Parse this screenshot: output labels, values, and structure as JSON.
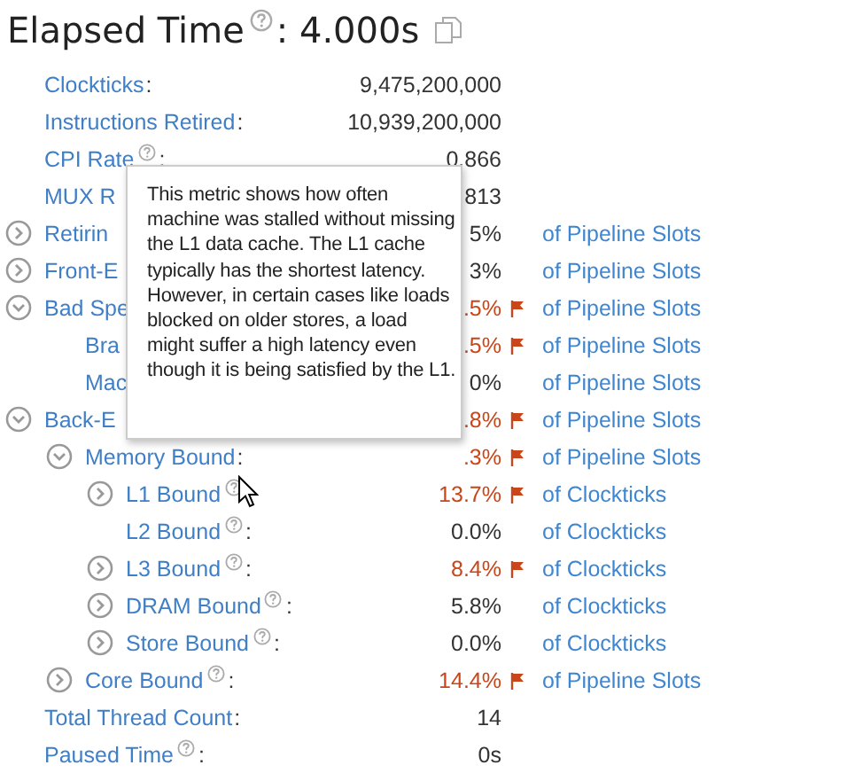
{
  "title": {
    "label": "Elapsed Time",
    "suffix": ":",
    "value": "4.000s"
  },
  "metrics": [
    {
      "label": "Clockticks",
      "suffix": ":",
      "value": "9,475,200,000"
    },
    {
      "label": "Instructions Retired",
      "suffix": ":",
      "value": "10,939,200,000"
    },
    {
      "label": "CPI Rate",
      "help": true,
      "suffix": ":",
      "value": "0.866"
    },
    {
      "label": "MUX R",
      "value": "813"
    },
    {
      "label": "Retirin",
      "expanded": false,
      "value": "5%",
      "flagged": false,
      "unit": "of Pipeline Slots"
    },
    {
      "label": "Front-E",
      "expanded": false,
      "value": "3%",
      "flagged": false,
      "unit": "of Pipeline Slots"
    },
    {
      "label": "Bad Spe",
      "expanded": true,
      "value": ".5%",
      "flagged": true,
      "unit": "of Pipeline Slots",
      "children": [
        {
          "label": "Bra",
          "value": ".5%",
          "flagged": true,
          "unit": "of Pipeline Slots"
        },
        {
          "label": "Mac",
          "value": "0%",
          "flagged": false,
          "unit": "of Pipeline Slots"
        }
      ]
    },
    {
      "label": "Back-E",
      "expanded": true,
      "value": ".8%",
      "flagged": true,
      "unit": "of Pipeline Slots",
      "children": [
        {
          "label": "Memory Bound",
          "suffix": ":",
          "expanded": true,
          "value": ".3%",
          "flagged": true,
          "unit": "of Pipeline Slots",
          "children": [
            {
              "label": "L1 Bound",
              "help": true,
              "expanded": false,
              "value": "13.7%",
              "flagged": true,
              "unit": "of Clockticks"
            },
            {
              "label": "L2 Bound",
              "help": true,
              "suffix": ":",
              "value": "0.0%",
              "flagged": false,
              "unit": "of Clockticks"
            },
            {
              "label": "L3 Bound",
              "help": true,
              "suffix": ":",
              "expanded": false,
              "value": "8.4%",
              "flagged": true,
              "unit": "of Clockticks"
            },
            {
              "label": "DRAM Bound",
              "help": true,
              "suffix": ":",
              "expanded": false,
              "value": "5.8%",
              "flagged": false,
              "unit": "of Clockticks"
            },
            {
              "label": "Store Bound",
              "help": true,
              "suffix": ":",
              "expanded": false,
              "value": "0.0%",
              "flagged": false,
              "unit": "of Clockticks"
            }
          ]
        },
        {
          "label": "Core Bound",
          "help": true,
          "suffix": ":",
          "expanded": false,
          "value": "14.4%",
          "flagged": true,
          "unit": "of Pipeline Slots"
        }
      ]
    },
    {
      "label": "Total Thread Count",
      "suffix": ":",
      "value": "14"
    },
    {
      "label": "Paused Time",
      "help": true,
      "suffix": ":",
      "value": "0s"
    }
  ],
  "tooltip": {
    "text": "This metric shows how often machine was stalled without missing the L1 data cache. The L1 cache typically has the shortest latency. However, in certain cases like loads blocked on older stores, a load might suffer a high latency even though it is being satisfied by the L1."
  }
}
